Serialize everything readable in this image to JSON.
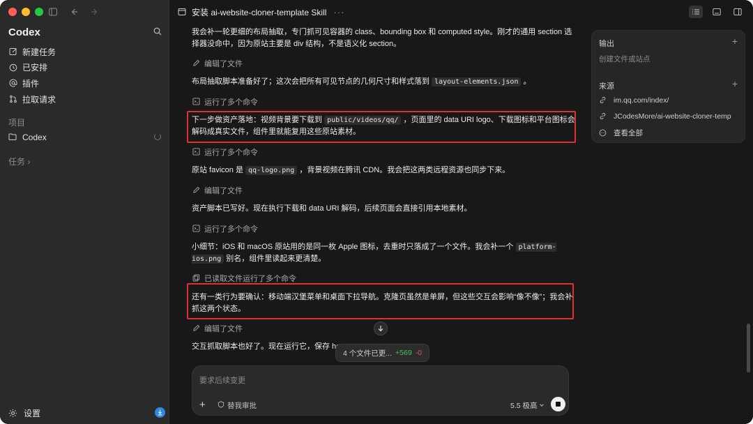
{
  "sidebar": {
    "brand": "Codex",
    "items": [
      {
        "label": "新建任务"
      },
      {
        "label": "已安排"
      },
      {
        "label": "插件"
      },
      {
        "label": "拉取请求"
      }
    ],
    "projects_label": "项目",
    "project_name": "Codex",
    "tasks_label": "任务 ›",
    "settings_label": "设置"
  },
  "header": {
    "title": "安装 ai-website-cloner-template Skill",
    "more": "···"
  },
  "chat": {
    "m1": "我会补一轮更细的布局抽取，专门抓可见容器的 class、bounding box 和 computed style。刚才的通用 section 选择器没命中，因为原站主要是 div 结构，不是语义化 section。",
    "a1": "编辑了文件",
    "m2_pre": "布局抽取脚本准备好了；这次会把所有可见节点的几何尺寸和样式落到",
    "m2_code": "layout-elements.json",
    "m2_post": "。",
    "a2": "运行了多个命令",
    "m3_pre": "下一步做资产落地：视频背景要下载到",
    "m3_code": "public/videos/qq/",
    "m3_post": "，页面里的 data URI logo、下载图标和平台图标会解码成真实文件，组件里就能复用这些原站素材。",
    "a3": "运行了多个命令",
    "m4_pre": "原站 favicon 是",
    "m4_code": "qq-logo.png",
    "m4_post": "，背景视频在腾讯 CDN。我会把这两类远程资源也同步下来。",
    "a4": "编辑了文件",
    "m5": "资产脚本已写好。现在执行下载和 data URI 解码，后续页面会直接引用本地素材。",
    "a5": "运行了多个命令",
    "m6_pre": "小细节：iOS 和 macOS 原站用的是同一枚 Apple 图标，去重时只落成了一个文件。我会补一个",
    "m6_code": "platform-ios.png",
    "m6_post": "别名，组件里读起来更清楚。",
    "a6": "已读取文件运行了多个命令",
    "m7": "还有一类行为要确认：移动端汉堡菜单和桌面下拉导航。克隆页虽然是单屏，但这些交互会影响“像不像”；我会补抓这两个状态。",
    "a7": "编辑了文件",
    "m8": "交互抓取脚本也好了。现在运行它，保存 hov"
  },
  "files_pill": {
    "label": "4 个文件已更...",
    "added": "+569",
    "removed": "-0"
  },
  "composer": {
    "placeholder": "要求后续变更",
    "approve_label": "替我审批",
    "model_label": "5.5 极高"
  },
  "panel": {
    "output_title": "输出",
    "output_sub": "创建文件或站点",
    "source_title": "来源",
    "links": [
      "im.qq.com/index/",
      "JCodesMore/ai-website-cloner-temp"
    ],
    "view_all": "查看全部"
  }
}
